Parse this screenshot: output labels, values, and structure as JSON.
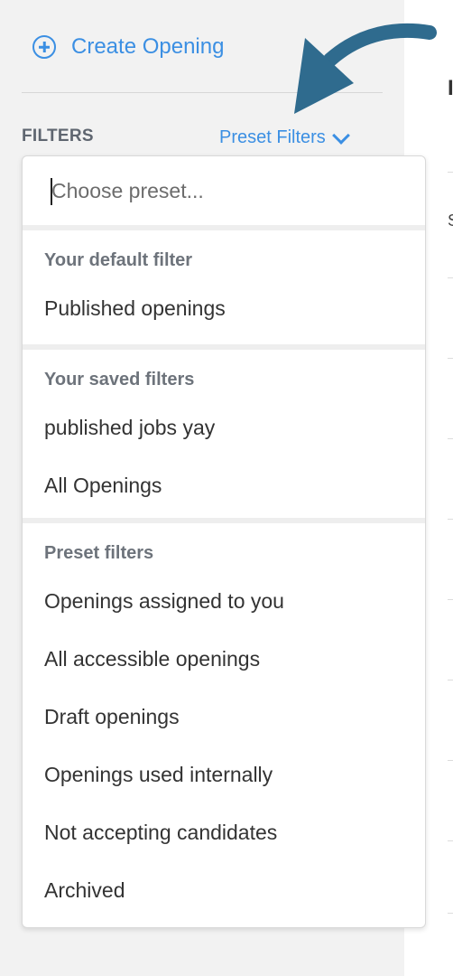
{
  "sidebar": {
    "create_opening_label": "Create Opening",
    "filters_title": "FILTERS",
    "preset_toggle_label": "Preset Filters"
  },
  "dropdown": {
    "search_placeholder": "Choose preset...",
    "groups": [
      {
        "header": "Your default filter",
        "options": [
          "Published openings"
        ]
      },
      {
        "header": "Your saved filters",
        "options": [
          "published jobs yay",
          "All Openings"
        ]
      },
      {
        "header": "Preset filters",
        "options": [
          "Openings assigned to you",
          "All accessible openings",
          "Draft openings",
          "Openings used internally",
          "Not accepting candidates",
          "Archived"
        ]
      }
    ]
  },
  "main_partial": {
    "heading_fragment": "I",
    "row_fragment": "S"
  },
  "colors": {
    "accent": "#3b8fe3",
    "annotation_arrow": "#2f6b8e",
    "sidebar_bg": "#f2f2f2"
  },
  "icons": {
    "create": "plus-circle-icon",
    "toggle": "chevron-down-icon",
    "annotation": "curved-arrow-icon"
  }
}
